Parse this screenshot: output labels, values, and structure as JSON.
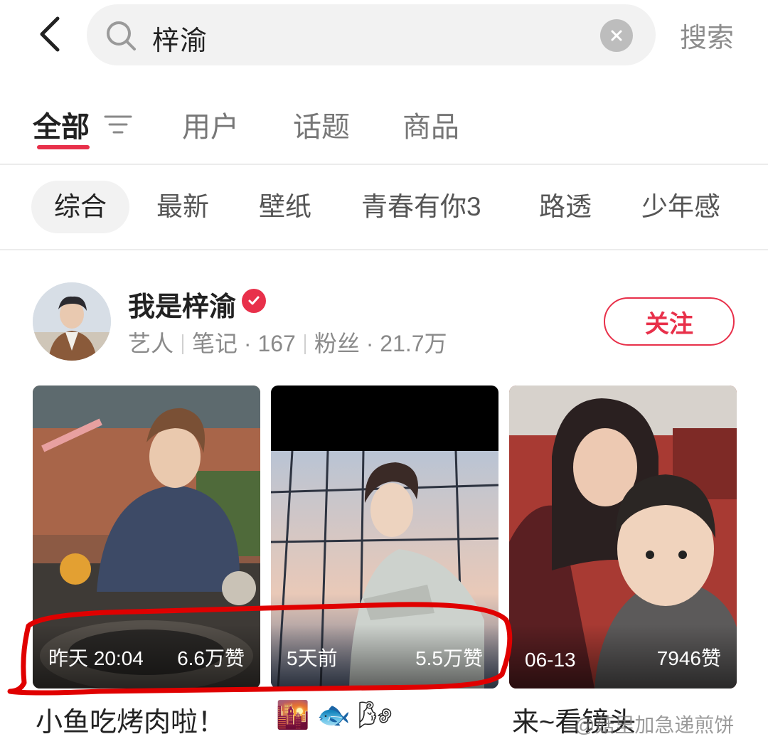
{
  "search": {
    "query": "梓渝",
    "button_label": "搜索"
  },
  "tabs": [
    {
      "label": "全部",
      "active": true
    },
    {
      "label": "用户"
    },
    {
      "label": "话题"
    },
    {
      "label": "商品"
    }
  ],
  "chips": [
    {
      "label": "综合",
      "active": true
    },
    {
      "label": "最新"
    },
    {
      "label": "壁纸"
    },
    {
      "label": "青春有你3"
    },
    {
      "label": "路透"
    },
    {
      "label": "少年感"
    }
  ],
  "user_card": {
    "name": "我是梓渝",
    "role": "艺人",
    "notes": "笔记 · 167",
    "fans": "粉丝 · 21.7万",
    "follow_label": "关注"
  },
  "posts": [
    {
      "time": "昨天 20:04",
      "likes": "6.6万赞",
      "caption": "小鱼吃烤肉啦！"
    },
    {
      "time": "5天前",
      "likes": "5.5万赞",
      "caption": "🌇 🐟 🌬"
    },
    {
      "time": "06-13",
      "likes": "7946赞",
      "caption": "来~看镜头"
    }
  ],
  "watermark": "@菇里加急递煎饼",
  "colors": {
    "accent": "#e8304a",
    "annotation": "#e00000"
  }
}
